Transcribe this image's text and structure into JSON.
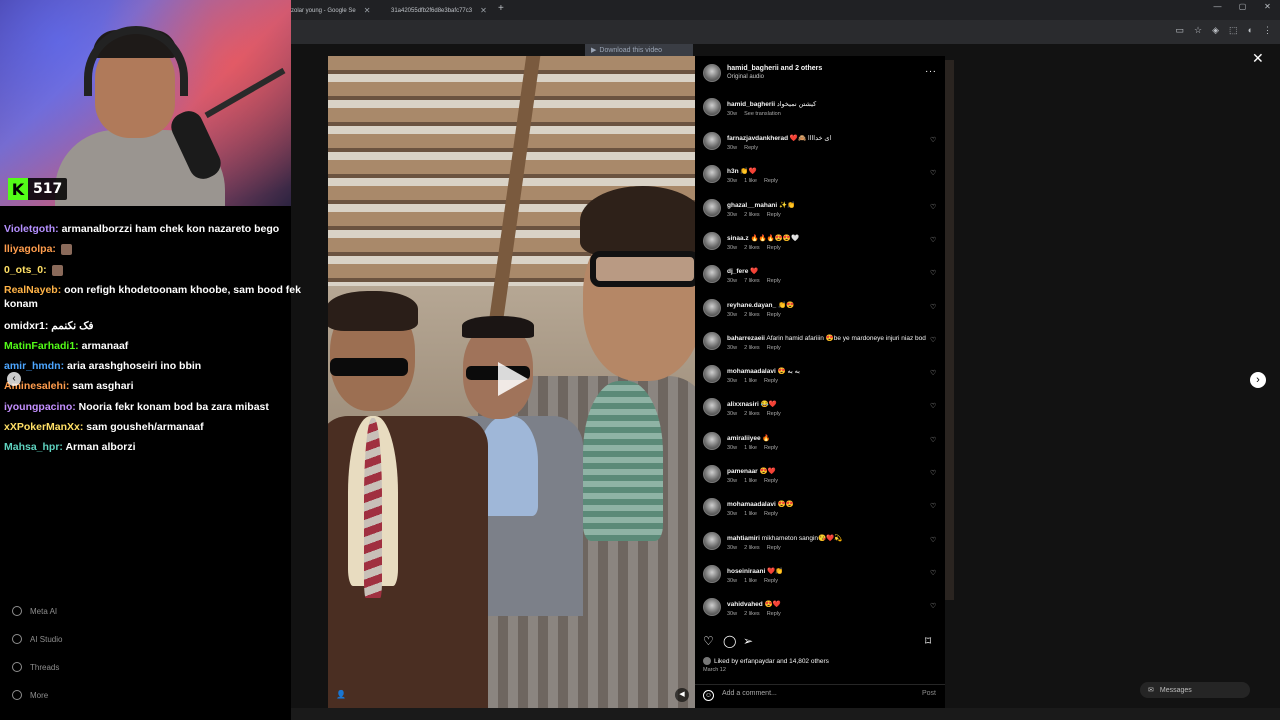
{
  "browser": {
    "tabs": [
      {
        "label": "zolar young - Google Se"
      },
      {
        "label": "31a42055dfb2f6d8e3bafc77c3"
      }
    ],
    "new_tab": "+",
    "window_controls": [
      "—",
      "▢",
      "✕"
    ]
  },
  "stream": {
    "viewer_count": "517",
    "kick_logo": "K"
  },
  "chat": {
    "messages": [
      {
        "user": "Violetgoth:",
        "color": "#b590ff",
        "text": "armanalborzzi ham chek kon nazareto bego"
      },
      {
        "user": "lliyagolpa:",
        "color": "#ff9d4d",
        "text": ""
      },
      {
        "user": "0_ots_0:",
        "color": "#ffe066",
        "text": ""
      },
      {
        "user": "RealNayeb:",
        "color": "#ffb347",
        "text": "oon refigh khodetoonam khoobe, sam bood fek konam"
      },
      {
        "user": "omidxr1:",
        "color": "#ffffff",
        "text": "فک نکنمم"
      },
      {
        "user": "MatinFarhadi1:",
        "color": "#53fc18",
        "text": "armanaaf"
      },
      {
        "user": "amir_hmdn:",
        "color": "#4da6ff",
        "text": "aria arashghoseiri ino bbin"
      },
      {
        "user": "Aminesalehi:",
        "color": "#ff9d4d",
        "text": "sam asghari"
      },
      {
        "user": "iyoungpacino:",
        "color": "#c490ff",
        "text": "Nooria fekr konam bod ba zara mibast"
      },
      {
        "user": "xXPokerManXx:",
        "color": "#ffe066",
        "text": "sam gousheh/armanaaf"
      },
      {
        "user": "Mahsa_hpr:",
        "color": "#5fd3c0",
        "text": "Arman alborzi"
      }
    ]
  },
  "ig_sidebar": [
    {
      "label": "Meta AI",
      "icon": "meta-ai-icon"
    },
    {
      "label": "AI Studio",
      "icon": "ai-studio-icon"
    },
    {
      "label": "Threads",
      "icon": "threads-icon"
    },
    {
      "label": "More",
      "icon": "menu-icon"
    }
  ],
  "download_banner": "Download this video",
  "post": {
    "header_name": "hamid_bagherii and 2 others",
    "header_audio": "Original audio",
    "more": "···",
    "caption": {
      "user": "hamid_bagherii",
      "text": "کیشتن نمیخواد",
      "age": "30w",
      "see_translation": "See translation"
    },
    "comments": [
      {
        "user": "farnazjavdankherad",
        "text": "❤️🙈 ای خداااا",
        "age": "30w",
        "likes": "",
        "reply": "Reply"
      },
      {
        "user": "h3n",
        "text": "👏❤️",
        "age": "30w",
        "likes": "1 like",
        "reply": "Reply"
      },
      {
        "user": "ghazal__mahani",
        "text": "✨👏",
        "age": "30w",
        "likes": "2 likes",
        "reply": "Reply"
      },
      {
        "user": "sinaa.z",
        "text": "🔥🔥🔥😍😍🤍",
        "age": "30w",
        "likes": "2 likes",
        "reply": "Reply"
      },
      {
        "user": "dj_fere",
        "text": "❤️",
        "age": "30w",
        "likes": "7 likes",
        "reply": "Reply"
      },
      {
        "user": "reyhane.dayan_",
        "text": "👏😍",
        "age": "30w",
        "likes": "2 likes",
        "reply": "Reply"
      },
      {
        "user": "baharrezaeii",
        "text": "Afarin hamid afariiin 😍be ye mardoneye injuri niaz bod vaghaaaan",
        "age": "30w",
        "likes": "2 likes",
        "reply": "Reply"
      },
      {
        "user": "mohamaadalavi",
        "text": "😍 به به",
        "age": "30w",
        "likes": "1 like",
        "reply": "Reply"
      },
      {
        "user": "alixxnasiri",
        "text": "😂❤️",
        "age": "30w",
        "likes": "2 likes",
        "reply": "Reply"
      },
      {
        "user": "amiraliiyee",
        "text": "🔥",
        "age": "30w",
        "likes": "1 like",
        "reply": "Reply"
      },
      {
        "user": "pamenaar",
        "text": "😍❤️",
        "age": "30w",
        "likes": "1 like",
        "reply": "Reply"
      },
      {
        "user": "mohamaadalavi",
        "text": "😍😍",
        "age": "30w",
        "likes": "1 like",
        "reply": "Reply"
      },
      {
        "user": "mahtiamiri",
        "text": "mikhameton sangin😘❤️💫",
        "age": "30w",
        "likes": "2 likes",
        "reply": "Reply"
      },
      {
        "user": "hoseiniraani",
        "text": "❤️👏",
        "age": "30w",
        "likes": "1 like",
        "reply": "Reply"
      },
      {
        "user": "vahidvahed",
        "text": "😍❤️",
        "age": "30w",
        "likes": "2 likes",
        "reply": "Reply"
      }
    ],
    "liked_by": "Liked by erfanpaydar and 14,802 others",
    "date": "March 12",
    "comment_placeholder": "Add a comment...",
    "post_button": "Post"
  },
  "messages_pill": "Messages"
}
